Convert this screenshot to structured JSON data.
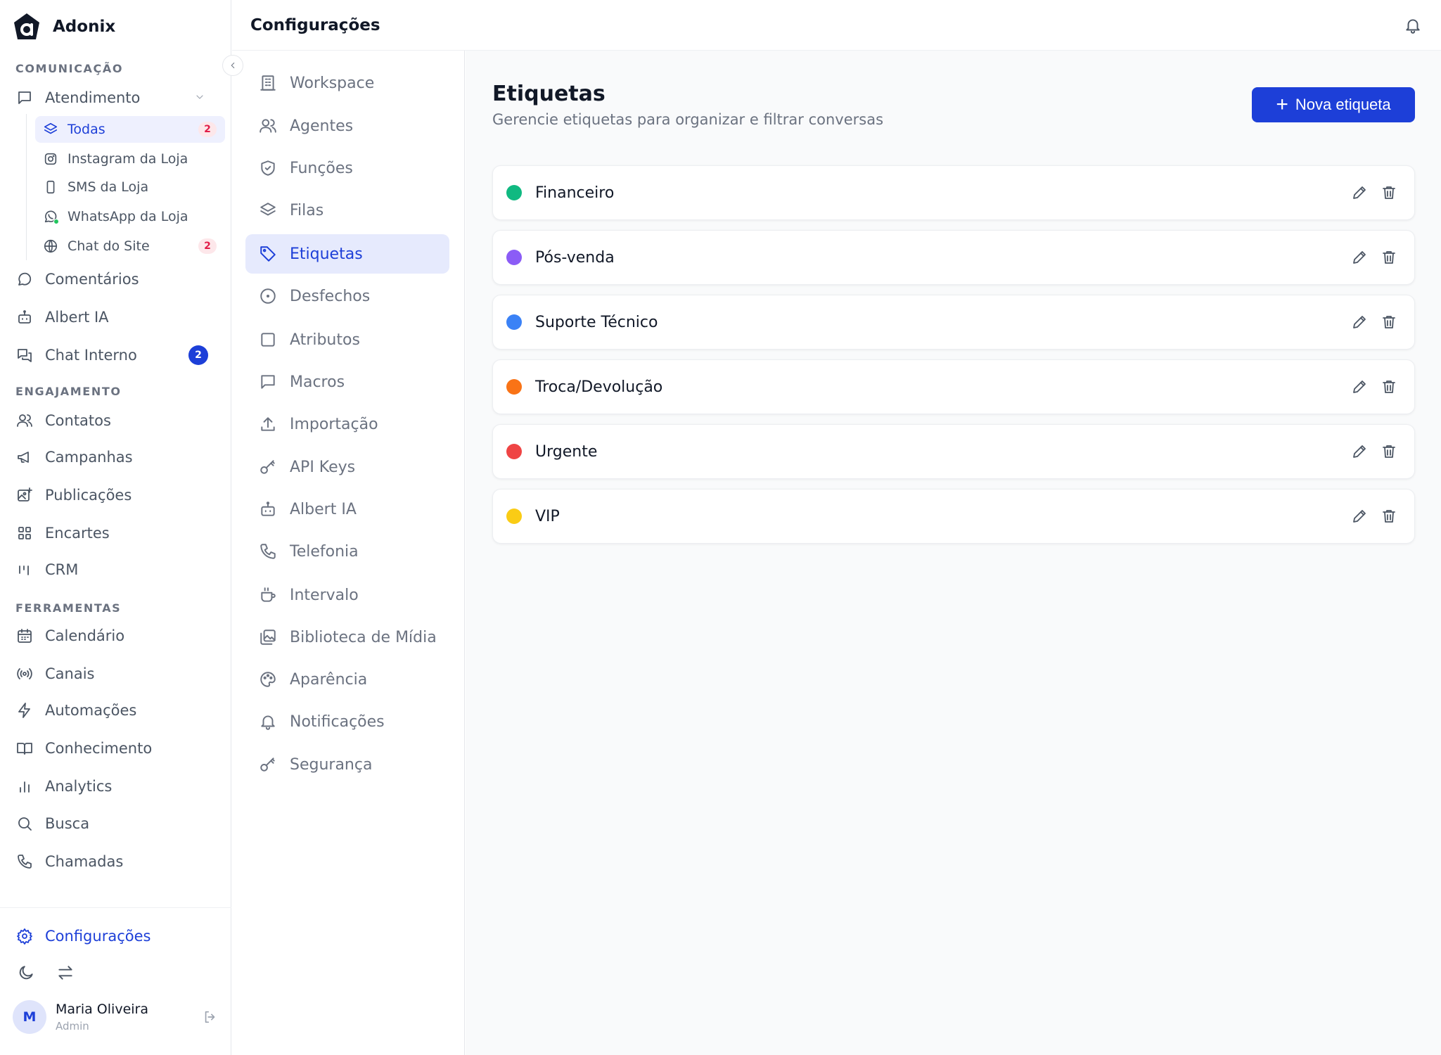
{
  "brand": {
    "name": "Adonix"
  },
  "header": {
    "title": "Configurações"
  },
  "sidebar": {
    "sections": {
      "comunicacao": "COMUNICAÇÃO",
      "engajamento": "ENGAJAMENTO",
      "ferramentas": "FERRAMENTAS"
    },
    "atendimento": {
      "label": "Atendimento",
      "subitems": [
        {
          "label": "Todas",
          "badge": "2",
          "icon": "layers-icon"
        },
        {
          "label": "Instagram da Loja",
          "icon": "instagram-icon"
        },
        {
          "label": "SMS da Loja",
          "icon": "phone-device-icon"
        },
        {
          "label": "WhatsApp da Loja",
          "icon": "whatsapp-icon"
        },
        {
          "label": "Chat do Site",
          "badge": "2",
          "icon": "globe-icon"
        }
      ]
    },
    "items": {
      "comentarios": "Comentários",
      "albert_ia": "Albert IA",
      "chat_interno": "Chat Interno",
      "chat_interno_badge": "2",
      "contatos": "Contatos",
      "campanhas": "Campanhas",
      "publicacoes": "Publicações",
      "encartes": "Encartes",
      "crm": "CRM",
      "calendario": "Calendário",
      "canais": "Canais",
      "automacoes": "Automações",
      "conhecimento": "Conhecimento",
      "analytics": "Analytics",
      "busca": "Busca",
      "chamadas": "Chamadas"
    },
    "settings": "Configurações",
    "user": {
      "initial": "M",
      "name": "Maria Oliveira",
      "role": "Admin"
    }
  },
  "settings_nav": {
    "items": [
      {
        "label": "Workspace",
        "icon": "building-icon"
      },
      {
        "label": "Agentes",
        "icon": "users-icon"
      },
      {
        "label": "Funções",
        "icon": "shield-check-icon"
      },
      {
        "label": "Filas",
        "icon": "layers-icon"
      },
      {
        "label": "Etiquetas",
        "icon": "tag-icon",
        "active": true
      },
      {
        "label": "Desfechos",
        "icon": "circle-dot-icon"
      },
      {
        "label": "Atributos",
        "icon": "square-icon"
      },
      {
        "label": "Macros",
        "icon": "message-square-icon"
      },
      {
        "label": "Importação",
        "icon": "upload-icon"
      },
      {
        "label": "API Keys",
        "icon": "key-icon"
      },
      {
        "label": "Albert IA",
        "icon": "bot-icon"
      },
      {
        "label": "Telefonia",
        "icon": "phone-icon"
      },
      {
        "label": "Intervalo",
        "icon": "coffee-icon"
      },
      {
        "label": "Biblioteca de Mídia",
        "icon": "image-library-icon"
      },
      {
        "label": "Aparência",
        "icon": "palette-icon"
      },
      {
        "label": "Notificações",
        "icon": "bell-icon"
      },
      {
        "label": "Segurança",
        "icon": "key-icon"
      }
    ]
  },
  "main": {
    "title": "Etiquetas",
    "subtitle": "Gerencie etiquetas para organizar e filtrar conversas",
    "new_button": "Nova etiqueta",
    "tags": [
      {
        "name": "Financeiro",
        "color": "#10b981"
      },
      {
        "name": "Pós-venda",
        "color": "#8b5cf6"
      },
      {
        "name": "Suporte Técnico",
        "color": "#3b82f6"
      },
      {
        "name": "Troca/Devolução",
        "color": "#f97316"
      },
      {
        "name": "Urgente",
        "color": "#ef4444"
      },
      {
        "name": "VIP",
        "color": "#facc15"
      }
    ]
  },
  "colors": {
    "accent": "#1d3fd8",
    "active_bg": "#e6eafd",
    "badge_bg": "#fde7ea",
    "badge_text": "#e11d48"
  }
}
